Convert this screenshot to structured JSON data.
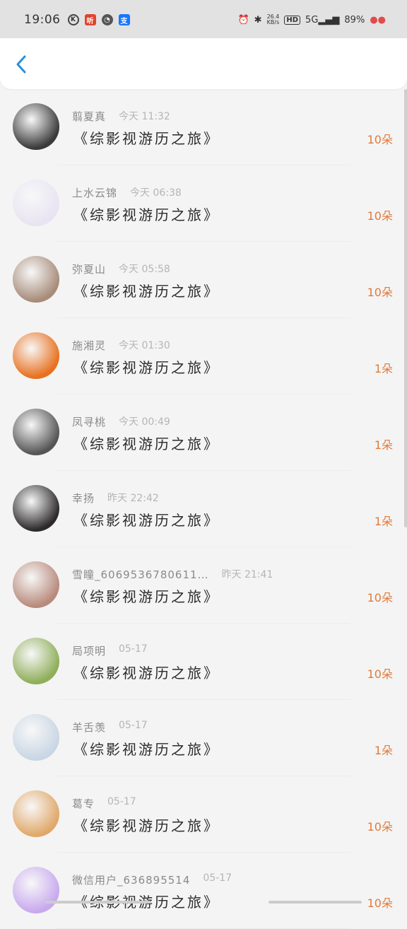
{
  "status": {
    "time": "19:06",
    "net_speed": "26.4",
    "net_unit": "KB/s",
    "hd": "HD",
    "signal": "5G",
    "battery": "89%"
  },
  "list": [
    {
      "name": "翦夏真",
      "time": "今天 11:32",
      "book": "《综影视游历之旅》",
      "amount": "10朵",
      "color": "#3a3a3a"
    },
    {
      "name": "上水云锦",
      "time": "今天 06:38",
      "book": "《综影视游历之旅》",
      "amount": "10朵",
      "color": "#e8e4f2"
    },
    {
      "name": "弥夏山",
      "time": "今天 05:58",
      "book": "《综影视游历之旅》",
      "amount": "10朵",
      "color": "#a78c7a"
    },
    {
      "name": "施湘灵",
      "time": "今天 01:30",
      "book": "《综影视游历之旅》",
      "amount": "1朵",
      "color": "#e8701f"
    },
    {
      "name": "凤寻桃",
      "time": "今天 00:49",
      "book": "《综影视游历之旅》",
      "amount": "1朵",
      "color": "#555555"
    },
    {
      "name": "幸扬",
      "time": "昨天 22:42",
      "book": "《综影视游历之旅》",
      "amount": "1朵",
      "color": "#2d2a2a"
    },
    {
      "name": "雪瞳_6069536780611…",
      "time": "昨天 21:41",
      "book": "《综影视游历之旅》",
      "amount": "10朵",
      "color": "#b88a7c"
    },
    {
      "name": "局项明",
      "time": "05-17",
      "book": "《综影视游历之旅》",
      "amount": "10朵",
      "color": "#8fae5a"
    },
    {
      "name": "羊舌羡",
      "time": "05-17",
      "book": "《综影视游历之旅》",
      "amount": "1朵",
      "color": "#c9d6e4"
    },
    {
      "name": "葛专",
      "time": "05-17",
      "book": "《综影视游历之旅》",
      "amount": "10朵",
      "color": "#e0a86a"
    },
    {
      "name": "微信用户_636895514",
      "time": "05-17",
      "book": "《综影视游历之旅》",
      "amount": "10朵",
      "color": "#c8a9ee"
    }
  ]
}
